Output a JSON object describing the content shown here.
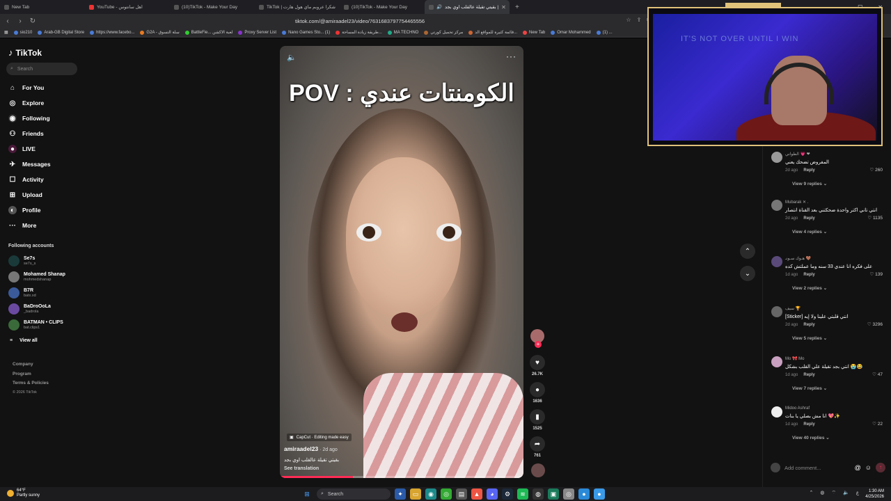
{
  "browser": {
    "tabs": [
      {
        "label": "New Tab",
        "active": false
      },
      {
        "label": "YouTube - اهل سانتوس",
        "active": false
      },
      {
        "label": "(10)TikTok - Make Your Day",
        "active": false
      },
      {
        "label": "TikTok | شكرا عروبم ماي هول هارت",
        "active": false
      },
      {
        "label": "(10)TikTok - Make Your Day",
        "active": false
      },
      {
        "label": "بقيتي تقيلة عالقلب اوي بجد |",
        "active": true
      }
    ],
    "new_tab": "+",
    "url": "tiktok.com/@amiraadel23/video/7631683797754465556",
    "bookmarks": [
      "sio210",
      "Arab-GB Digital Store",
      "https://www.facebo...",
      "G2A - سلة التسوق",
      "BattleFie... لعبة الاكشن",
      "Proxy Server List",
      "Nano Games Sto... (1)",
      "طريقة زيادة المساحة...",
      "MA TECHNO",
      "مركز تحميل كورتي",
      "قائمة كثيرة للمواقع الد...",
      "New Tab",
      "Omar Mohammed",
      "(1) ..."
    ]
  },
  "sidebar": {
    "logo": "TikTok",
    "search_placeholder": "Search",
    "nav": [
      {
        "label": "For You",
        "icon": "home-icon"
      },
      {
        "label": "Explore",
        "icon": "compass-icon"
      },
      {
        "label": "Following",
        "icon": "following-icon"
      },
      {
        "label": "Friends",
        "icon": "friends-icon"
      },
      {
        "label": "LIVE",
        "icon": "live-icon"
      },
      {
        "label": "Messages",
        "icon": "messages-icon"
      },
      {
        "label": "Activity",
        "icon": "activity-icon"
      },
      {
        "label": "Upload",
        "icon": "upload-icon"
      },
      {
        "label": "Profile",
        "icon": "profile-icon"
      },
      {
        "label": "More",
        "icon": "more-icon"
      }
    ],
    "following_header": "Following accounts",
    "accounts": [
      {
        "name": "Se7s",
        "handle": "se7s_s"
      },
      {
        "name": "Mohamed Shanap",
        "handle": "mohmedshanap"
      },
      {
        "name": "B7R",
        "handle": "batx.xd"
      },
      {
        "name": "BaDroOoLa",
        "handle": "_badrola"
      },
      {
        "name": "BATMAN • CLIPS",
        "handle": "bat.clips1"
      }
    ],
    "view_all": "View all",
    "footer": [
      "Company",
      "Program",
      "Terms & Policies"
    ],
    "copyright": "© 2026 TikTok"
  },
  "video": {
    "overlay_text": "POV : الكومنتات عندي",
    "capcut": "CapCut · Editing made easy",
    "author": "amiraadel23",
    "ago": " · 2d ago",
    "caption": "بقيتي تقيلة عالقلب اوي بجد",
    "see_translation": "See translation",
    "progress": 0.3
  },
  "actions": {
    "likes": "26.7K",
    "comments": "1636",
    "saves": "1525",
    "shares": "761"
  },
  "comments": [
    {
      "user": "الطواني 💗 ❤",
      "text": "المفروض تضحك يعني",
      "ago": "2d ago",
      "likes": "260",
      "view_replies": "View 9 replies"
    },
    {
      "user": "Mubarak ✕ .",
      "text": "انتي تاني اكتر واحدة ضحكتني بعد القناة انتصار",
      "ago": "2d ago",
      "likes": "1135",
      "view_replies": "View 4 replies"
    },
    {
      "user": "هـوك سـونـ 🤎",
      "text": "على فكره انا عندي 33 سنه وما عملتش كده",
      "ago": "1d ago",
      "likes": "139",
      "view_replies": "View 2 replies"
    },
    {
      "user": "سيف 🏆",
      "text": "[Sticker] انتي قلبتي علينا ولا إيه",
      "ago": "2d ago",
      "likes": "3296",
      "view_replies": "View 5 replies"
    },
    {
      "user": "Mo 🎀 Mo",
      "text": "انتي بجد تقيلة علي القلب بشكل 😭😂",
      "ago": "1d ago",
      "likes": "47",
      "view_replies": "View 7 replies"
    },
    {
      "user": "Midoo Ashraf",
      "text": "انا مش بصلي يا بنات 💖✨",
      "ago": "1d ago",
      "likes": "22",
      "view_replies": "View 40 replies"
    }
  ],
  "reply_label": "Reply",
  "add_comment_placeholder": "Add comment...",
  "webcam": {
    "poster": "IT'S NOT OVER UNTIL I WIN"
  },
  "taskbar": {
    "temp": "64°F",
    "weather": "Partly sunny",
    "search": "Search",
    "time": "1:30 AM",
    "date": "4/25/2026"
  },
  "colors": {
    "accent": "#fe2c55",
    "frame": "#e0c27a"
  }
}
